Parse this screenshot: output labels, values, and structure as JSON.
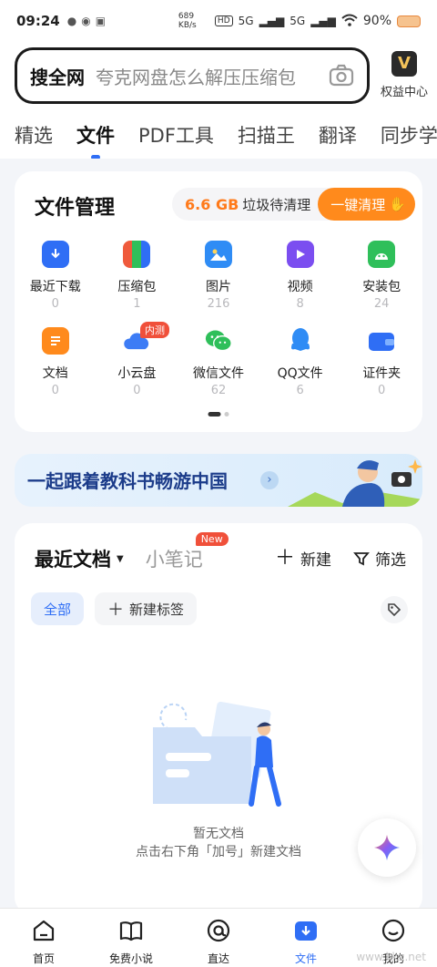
{
  "status_bar": {
    "time": "09:24",
    "net_speed": "689 KB/s",
    "network_1": "5G",
    "network_2": "5G",
    "battery": "90%"
  },
  "search": {
    "tag": "搜全网",
    "placeholder": "夸克网盘怎么解压压缩包"
  },
  "vip": {
    "badge": "V",
    "label": "权益中心"
  },
  "tabs": [
    {
      "label": "精选"
    },
    {
      "label": "文件",
      "active": true
    },
    {
      "label": "PDF工具"
    },
    {
      "label": "扫描王"
    },
    {
      "label": "翻译"
    },
    {
      "label": "同步学"
    }
  ],
  "file_manager": {
    "title": "文件管理",
    "junk_size": "6.6 GB",
    "junk_text": "垃圾待清理",
    "clean_button": "一键清理",
    "items": [
      {
        "name": "最近下载",
        "count": "0",
        "icon": "download-icon",
        "color": "#2f6ef5"
      },
      {
        "name": "压缩包",
        "count": "1",
        "icon": "archive-icon",
        "color": "#ef5a3c"
      },
      {
        "name": "图片",
        "count": "216",
        "icon": "image-icon",
        "color": "#2f8cf5"
      },
      {
        "name": "视频",
        "count": "8",
        "icon": "video-icon",
        "color": "#7b4ef0"
      },
      {
        "name": "安装包",
        "count": "24",
        "icon": "android-icon",
        "color": "#2fbf5a"
      },
      {
        "name": "文档",
        "count": "0",
        "icon": "document-icon",
        "color": "#ff8a1c"
      },
      {
        "name": "小云盘",
        "count": "0",
        "icon": "cloud-icon",
        "color": "#3d7cf5",
        "tag": "内测"
      },
      {
        "name": "微信文件",
        "count": "62",
        "icon": "wechat-icon",
        "color": "#2fbf5a"
      },
      {
        "name": "QQ文件",
        "count": "6",
        "icon": "qq-icon",
        "color": "#2f8cf5"
      },
      {
        "name": "证件夹",
        "count": "0",
        "icon": "wallet-icon",
        "color": "#2f6ef5"
      }
    ]
  },
  "banner": {
    "text": "一起跟着教科书畅游中国",
    "arrow": "›"
  },
  "recent": {
    "title": "最近文档",
    "notes_tab": "小笔记",
    "notes_badge": "New",
    "new_button": "新建",
    "filter_button": "筛选",
    "chip_all": "全部",
    "chip_new_tag": "新建标签",
    "empty_title": "暂无文档",
    "empty_hint": "点击右下角「加号」新建文档"
  },
  "bottom_nav": [
    {
      "label": "首页",
      "icon": "home-icon"
    },
    {
      "label": "免费小说",
      "icon": "book-icon"
    },
    {
      "label": "直达",
      "icon": "at-icon"
    },
    {
      "label": "文件",
      "icon": "file-download-icon",
      "active": true
    },
    {
      "label": "我的",
      "icon": "profile-icon"
    }
  ],
  "watermark": "www.kkx.net"
}
